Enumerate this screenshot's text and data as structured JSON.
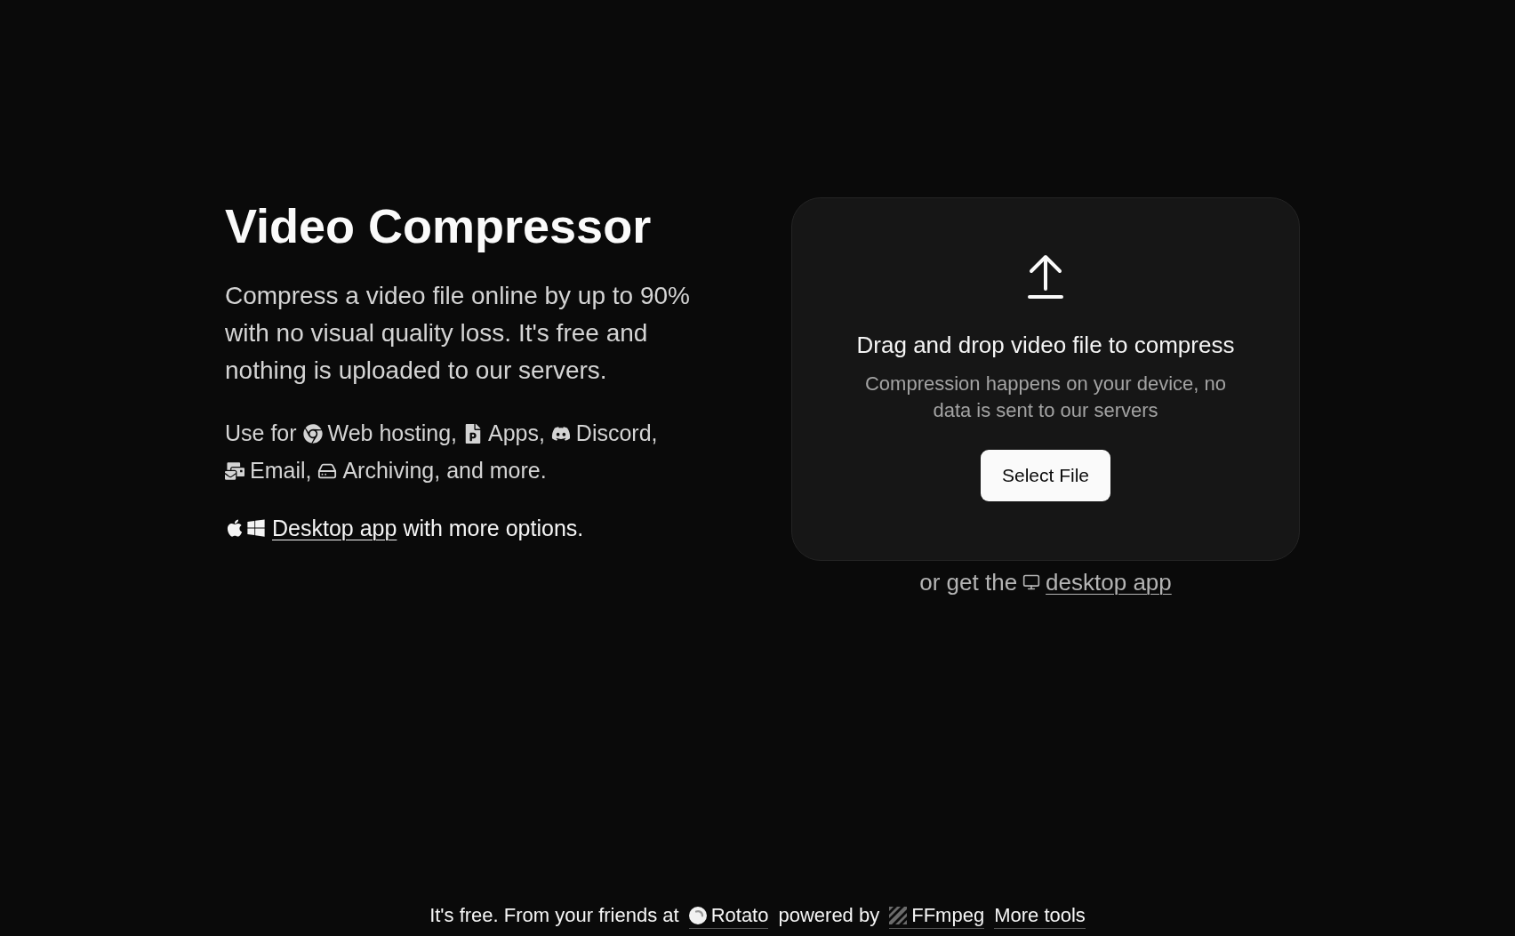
{
  "hero": {
    "title": "Video Compressor",
    "description": "Compress a video file online by up to 90% with no visual quality loss. It's free and nothing is uploaded to our servers.",
    "use_for": {
      "label": "Use for",
      "items": [
        "Web hosting,",
        "Apps,",
        "Discord,",
        "Email,",
        "Archiving,"
      ],
      "tail": "and more."
    },
    "desktop": {
      "link": "Desktop app",
      "text": "with more options."
    }
  },
  "dropzone": {
    "heading": "Drag and drop video file to compress",
    "note": "Compression happens on your device, no data is sent to our servers",
    "button": "Select File"
  },
  "desktop_prompt": {
    "text": "or get the",
    "link": "desktop app"
  },
  "footer": {
    "lead": "It's free. From your friends at",
    "rotato_link": "Rotato",
    "middle": "powered by",
    "ffmpeg_link": "FFmpeg",
    "tools_link": "More tools"
  }
}
